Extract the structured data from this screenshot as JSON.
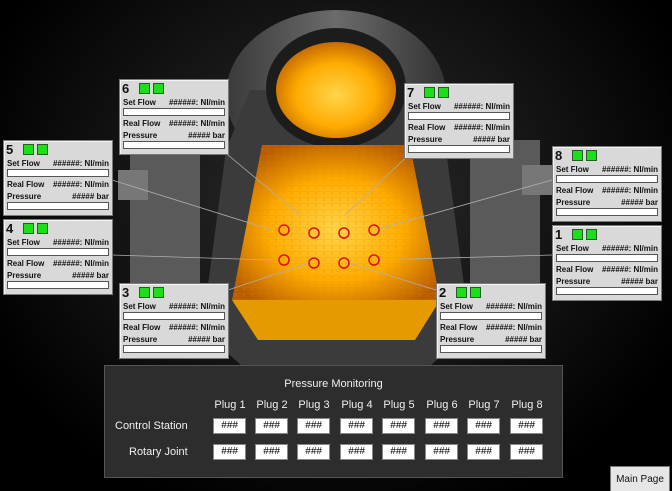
{
  "labels": {
    "set_flow": "Set Flow",
    "real_flow": "Real Flow",
    "pressure": "Pressure"
  },
  "panels": [
    {
      "num": "6",
      "set_val": "######: Nl/min",
      "real_val": "######: Nl/min",
      "press_val": "#####  bar"
    },
    {
      "num": "7",
      "set_val": "######: Nl/min",
      "real_val": "######: Nl/min",
      "press_val": "#####  bar"
    },
    {
      "num": "5",
      "set_val": "######: Nl/min",
      "real_val": "######: Nl/min",
      "press_val": "#####  bar"
    },
    {
      "num": "8",
      "set_val": "######: Nl/min",
      "real_val": "######: Nl/min",
      "press_val": "#####  bar"
    },
    {
      "num": "4",
      "set_val": "######: Nl/min",
      "real_val": "######: Nl/min",
      "press_val": "#####  bar"
    },
    {
      "num": "1",
      "set_val": "######: Nl/min",
      "real_val": "######: Nl/min",
      "press_val": "#####  bar"
    },
    {
      "num": "3",
      "set_val": "######: Nl/min",
      "real_val": "######: Nl/min",
      "press_val": "#####  bar"
    },
    {
      "num": "2",
      "set_val": "######: Nl/min",
      "real_val": "######: Nl/min",
      "press_val": "#####  bar"
    }
  ],
  "pressure_monitoring": {
    "title": "Pressure Monitoring",
    "columns": [
      "Plug 1",
      "Plug 2",
      "Plug 3",
      "Plug 4",
      "Plug 5",
      "Plug 6",
      "Plug 7",
      "Plug 8"
    ],
    "rows": [
      {
        "label": "Control Station",
        "values": [
          "###",
          "###",
          "###",
          "###",
          "###",
          "###",
          "###",
          "###"
        ]
      },
      {
        "label": "Rotary Joint",
        "values": [
          "###",
          "###",
          "###",
          "###",
          "###",
          "###",
          "###",
          "###"
        ]
      }
    ]
  },
  "main_page_button": "Main Page",
  "colors": {
    "indicator": "#19e019",
    "vessel_hot": "#ffb300",
    "plug_marker": "#e01010"
  }
}
